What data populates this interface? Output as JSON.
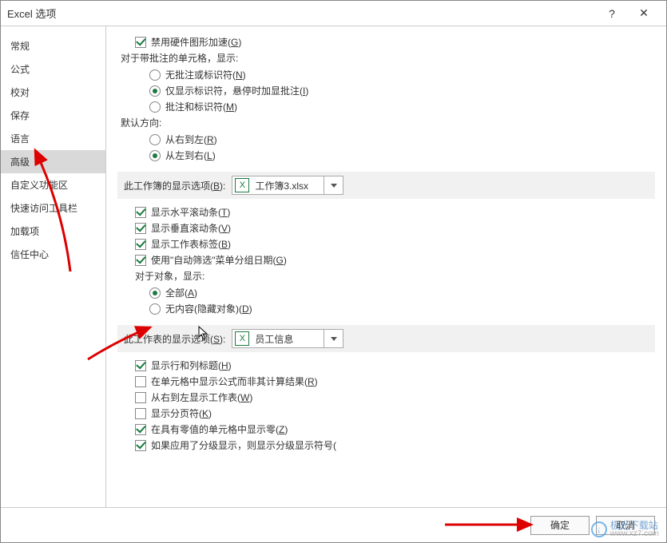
{
  "title": "Excel 选项",
  "sidebar": {
    "items": [
      {
        "label": "常规"
      },
      {
        "label": "公式"
      },
      {
        "label": "校对"
      },
      {
        "label": "保存"
      },
      {
        "label": "语言"
      },
      {
        "label": "高级"
      },
      {
        "label": "自定义功能区"
      },
      {
        "label": "快速访问工具栏"
      },
      {
        "label": "加载项"
      },
      {
        "label": "信任中心"
      }
    ],
    "selected_index": 5
  },
  "content": {
    "disable_hw": {
      "label": "禁用硬件图形加速(",
      "key": "G",
      "tail": ")"
    },
    "comments_header": "对于带批注的单元格，显示:",
    "comments": {
      "opt1": {
        "label": "无批注或标识符(",
        "key": "N",
        "tail": ")"
      },
      "opt2": {
        "label": "仅显示标识符，悬停时加显批注(",
        "key": "I",
        "tail": ")"
      },
      "opt3": {
        "label": "批注和标识符(",
        "key": "M",
        "tail": ")"
      },
      "selected": 1
    },
    "dir_header": "默认方向:",
    "dir": {
      "rtl": {
        "label": "从右到左(",
        "key": "R",
        "tail": ")"
      },
      "ltr": {
        "label": "从左到右(",
        "key": "L",
        "tail": ")"
      },
      "selected": 1
    },
    "wb_section": {
      "label": "此工作簿的显示选项(",
      "key": "B",
      "tail": "):",
      "value": "工作簿3.xlsx"
    },
    "wb_opts": {
      "hscroll": {
        "label": "显示水平滚动条(",
        "key": "T",
        "tail": ")",
        "checked": true
      },
      "vscroll": {
        "label": "显示垂直滚动条(",
        "key": "V",
        "tail": ")",
        "checked": true
      },
      "tabs": {
        "label": "显示工作表标签(",
        "key": "B",
        "tail": ")",
        "checked": true
      },
      "autofilter": {
        "label": "使用\"自动筛选\"菜单分组日期(",
        "key": "G",
        "tail": ")",
        "checked": true
      }
    },
    "objects_header": "对于对象，显示:",
    "objects": {
      "all": {
        "label": "全部(",
        "key": "A",
        "tail": ")"
      },
      "none": {
        "label": "无内容(隐藏对象)(",
        "key": "D",
        "tail": ")"
      },
      "selected": 0
    },
    "ws_section": {
      "label": "此工作表的显示选项(",
      "key": "S",
      "tail": "):",
      "value": "员工信息"
    },
    "ws_opts": {
      "headers": {
        "label": "显示行和列标题(",
        "key": "H",
        "tail": ")",
        "checked": true
      },
      "formulas": {
        "label": "在单元格中显示公式而非其计算结果(",
        "key": "R",
        "tail": ")",
        "checked": false
      },
      "rtl_sheet": {
        "label": "从右到左显示工作表(",
        "key": "W",
        "tail": ")",
        "checked": false
      },
      "pagebreaks": {
        "label": "显示分页符(",
        "key": "K",
        "tail": ")",
        "checked": false
      },
      "zeros": {
        "label": "在具有零值的单元格中显示零(",
        "key": "Z",
        "tail": ")",
        "checked": true
      },
      "outline": {
        "label": "如果应用了分级显示，则显示分级显示符号(",
        "key": "",
        "tail": "",
        "checked": true
      }
    }
  },
  "footer": {
    "ok": "确定",
    "cancel": "取消"
  },
  "watermark": {
    "name": "极光下载站",
    "url": "www.xz7.com"
  }
}
